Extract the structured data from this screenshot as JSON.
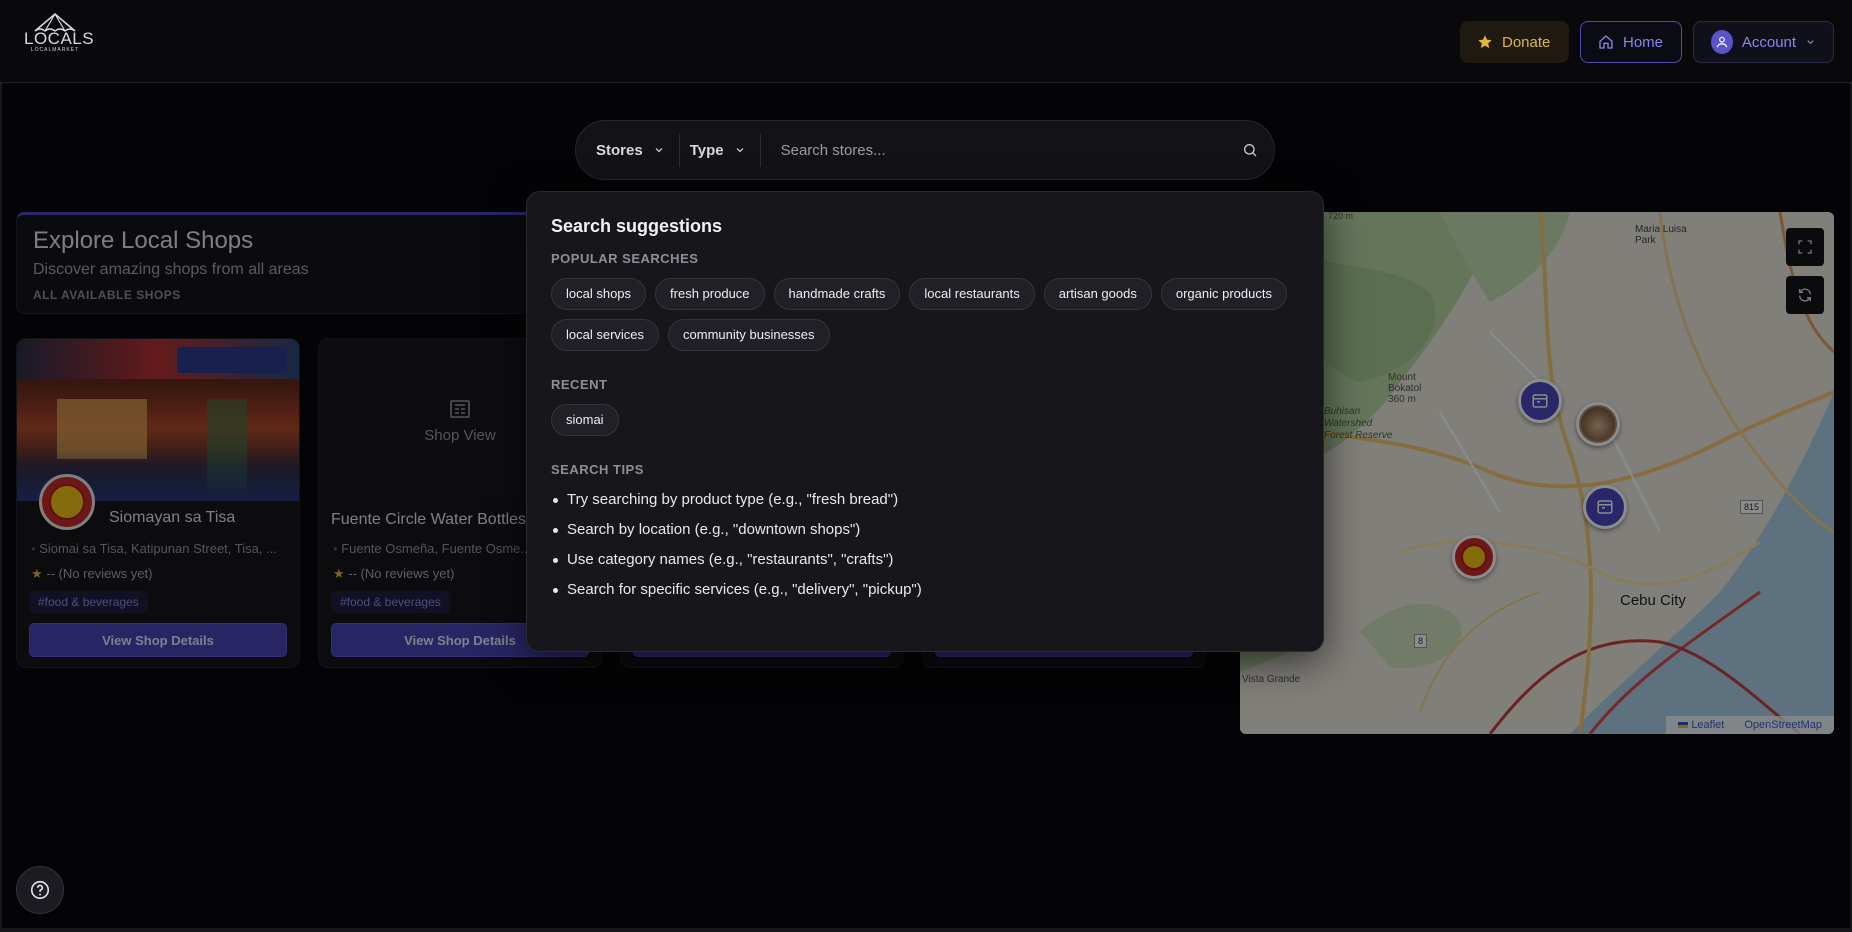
{
  "brand": {
    "name": "LOCALS",
    "subtitle": "LOCALMARKET"
  },
  "header": {
    "donate_label": "Donate",
    "home_label": "Home",
    "account_label": "Account"
  },
  "search": {
    "stores_label": "Stores",
    "type_label": "Type",
    "placeholder": "Search stores..."
  },
  "explore": {
    "title": "Explore Local Shops",
    "subtitle": "Discover amazing shops from all areas",
    "tag": "ALL AVAILABLE SHOPS"
  },
  "shops": [
    {
      "name": "Siomayan sa Tisa",
      "address": "Siomai sa Tisa, Katipunan Street, Tisa, ...",
      "rating": "-- (No reviews yet)",
      "hashtag": "#food & beverages",
      "button": "View Shop Details"
    },
    {
      "name": "Fuente Circle Water Bottles",
      "placeholder_label": "Shop View",
      "address": "Fuente Osmeña, Fuente Osme...",
      "rating": "-- (No reviews yet)",
      "hashtag": "#food & beverages",
      "button": "View Shop Details"
    }
  ],
  "suggestions": {
    "title": "Search suggestions",
    "popular_label": "POPULAR SEARCHES",
    "popular": [
      "local shops",
      "fresh produce",
      "handmade crafts",
      "local restaurants",
      "artisan goods",
      "organic products",
      "local services",
      "community businesses"
    ],
    "recent_label": "RECENT",
    "recent": [
      "siomai"
    ],
    "tips_label": "SEARCH TIPS",
    "tips": [
      "Try searching by product type (e.g., \"fresh bread\")",
      "Search by location (e.g., \"downtown shops\")",
      "Use category names (e.g., \"restaurants\", \"crafts\")",
      "Search for specific services (e.g., \"delivery\", \"pickup\")"
    ]
  },
  "map": {
    "city_label": "Cebu City",
    "place_labels": [
      "Maria Luisa Park",
      "Mount Bokatol 360 m",
      "Buhisan Watershed Forest Reserve",
      "Vista Grande",
      "815",
      "8",
      "720 m"
    ],
    "attribution_leaflet": "Leaflet",
    "attribution_osm": "OpenStreetMap"
  },
  "colors": {
    "accent": "#4944b8",
    "donate": "#e0b441",
    "background": "#08080b"
  }
}
